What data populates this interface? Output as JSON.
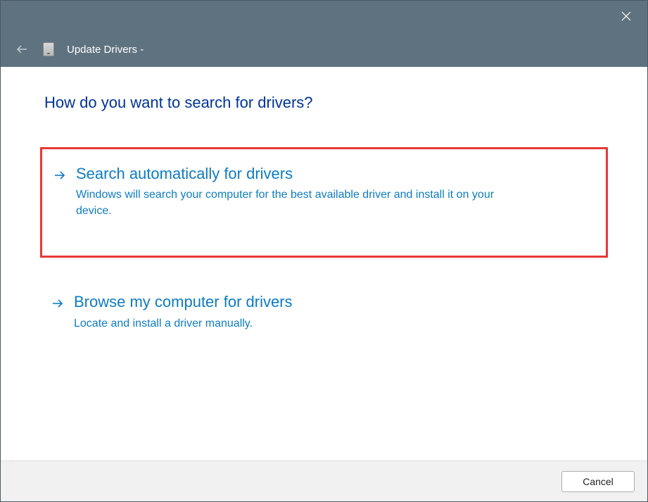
{
  "header": {
    "title": "Update Drivers -"
  },
  "page": {
    "title": "How do you want to search for drivers?"
  },
  "options": {
    "auto": {
      "title": "Search automatically for drivers",
      "desc": "Windows will search your computer for the best available driver and install it on your device."
    },
    "browse": {
      "title": "Browse my computer for drivers",
      "desc": "Locate and install a driver manually."
    }
  },
  "footer": {
    "cancel": "Cancel"
  }
}
